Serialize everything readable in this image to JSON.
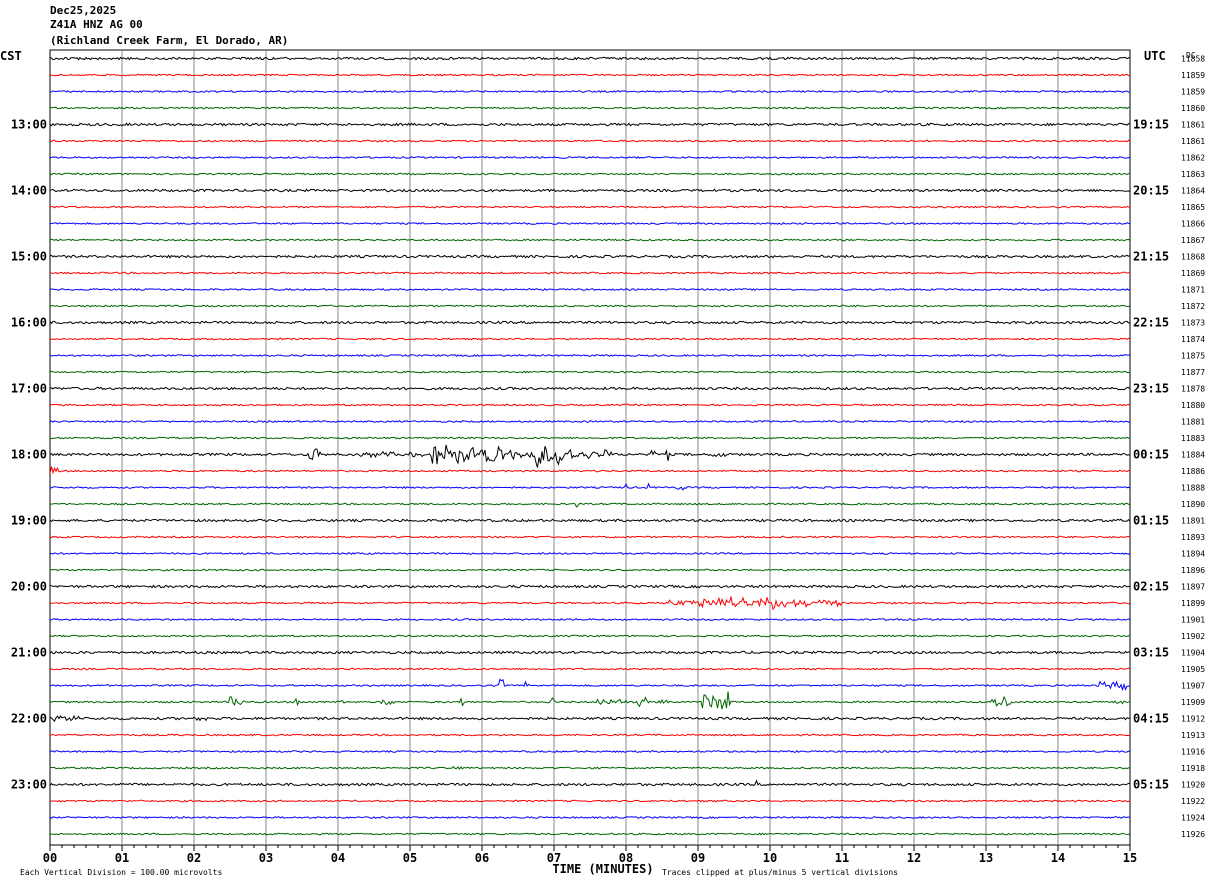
{
  "header": {
    "date": "Dec25,2025",
    "station": "Z41A HNZ AG 00",
    "location": "(Richland Creek Farm, El Dorado, AR)"
  },
  "chart_data": {
    "type": "line",
    "title": "Dec25,2025 Z41A HNZ AG 00 (Richland Creek Farm, El Dorado, AR)",
    "xlabel": "TIME (MINUTES)",
    "xlim": [
      0,
      15
    ],
    "x_ticks": [
      "00",
      "01",
      "02",
      "03",
      "04",
      "05",
      "06",
      "07",
      "08",
      "09",
      "10",
      "11",
      "12",
      "13",
      "14",
      "15"
    ],
    "left_axis_label": "CST",
    "right_axis_label": "UTC",
    "dc_label": "DC",
    "left_hour_labels": [
      "13:00",
      "14:00",
      "15:00",
      "16:00",
      "17:00",
      "18:00",
      "19:00",
      "20:00",
      "21:00",
      "22:00",
      "23:00"
    ],
    "right_hour_labels": [
      "19:15",
      "20:15",
      "21:15",
      "22:15",
      "23:15",
      "00:15",
      "01:15",
      "02:15",
      "03:15",
      "04:15",
      "05:15"
    ],
    "first_labeled_trace": 4,
    "trace_count": 48,
    "trace_colors": [
      "#000000",
      "#ff0000",
      "#0000ff",
      "#006600"
    ],
    "dc_values": [
      "11858",
      "11859",
      "11859",
      "11860",
      "11861",
      "11861",
      "11862",
      "11863",
      "11864",
      "11865",
      "11866",
      "11867",
      "11868",
      "11869",
      "11871",
      "11872",
      "11873",
      "11874",
      "11875",
      "11877",
      "11878",
      "11880",
      "11881",
      "11883",
      "11884",
      "11886",
      "11888",
      "11890",
      "11891",
      "11893",
      "11894",
      "11896",
      "11897",
      "11899",
      "11901",
      "11902",
      "11904",
      "11905",
      "11907",
      "11909",
      "11912",
      "11913",
      "11916",
      "11918",
      "11920",
      "11922",
      "11924",
      "11926"
    ],
    "events": [
      {
        "trace": 24,
        "start": 1.8,
        "end": 1.95,
        "amp": 0.12
      },
      {
        "trace": 24,
        "start": 2.55,
        "end": 2.65,
        "amp": 0.1
      },
      {
        "trace": 24,
        "start": 3.6,
        "end": 3.75,
        "amp": 0.55
      },
      {
        "trace": 24,
        "start": 4.3,
        "end": 5.3,
        "amp": 0.18
      },
      {
        "trace": 24,
        "start": 5.3,
        "end": 6.3,
        "amp": 0.75
      },
      {
        "trace": 24,
        "start": 6.3,
        "end": 6.75,
        "amp": 0.35
      },
      {
        "trace": 24,
        "start": 6.75,
        "end": 7.3,
        "amp": 0.9
      },
      {
        "trace": 24,
        "start": 7.3,
        "end": 7.8,
        "amp": 0.35
      },
      {
        "trace": 24,
        "start": 8.35,
        "end": 8.4,
        "amp": 0.6
      },
      {
        "trace": 24,
        "start": 8.55,
        "end": 8.6,
        "amp": 0.8
      },
      {
        "trace": 24,
        "start": 9.2,
        "end": 9.4,
        "amp": 0.2
      },
      {
        "trace": 24,
        "start": 12.8,
        "end": 12.9,
        "amp": 0.15
      },
      {
        "trace": 25,
        "start": 0.0,
        "end": 0.12,
        "amp": 0.3
      },
      {
        "trace": 26,
        "start": 7.95,
        "end": 8.0,
        "amp": 0.3
      },
      {
        "trace": 26,
        "start": 8.3,
        "end": 8.35,
        "amp": 0.35
      },
      {
        "trace": 26,
        "start": 8.7,
        "end": 8.8,
        "amp": 0.3
      },
      {
        "trace": 27,
        "start": 7.3,
        "end": 7.35,
        "amp": 0.3
      },
      {
        "trace": 33,
        "start": 8.6,
        "end": 11.0,
        "amp": 0.25
      },
      {
        "trace": 33,
        "start": 9.0,
        "end": 10.2,
        "amp": 0.45
      },
      {
        "trace": 34,
        "start": 11.7,
        "end": 11.8,
        "amp": 0.1
      },
      {
        "trace": 38,
        "start": 6.25,
        "end": 6.3,
        "amp": 0.5
      },
      {
        "trace": 38,
        "start": 6.6,
        "end": 6.65,
        "amp": 0.55
      },
      {
        "trace": 38,
        "start": 14.55,
        "end": 14.95,
        "amp": 0.35
      },
      {
        "trace": 39,
        "start": 2.5,
        "end": 2.7,
        "amp": 0.35
      },
      {
        "trace": 39,
        "start": 3.4,
        "end": 3.5,
        "amp": 0.3
      },
      {
        "trace": 39,
        "start": 4.0,
        "end": 4.1,
        "amp": 0.3
      },
      {
        "trace": 39,
        "start": 4.6,
        "end": 4.8,
        "amp": 0.25
      },
      {
        "trace": 39,
        "start": 5.7,
        "end": 5.8,
        "amp": 0.3
      },
      {
        "trace": 39,
        "start": 6.95,
        "end": 7.0,
        "amp": 0.3
      },
      {
        "trace": 39,
        "start": 7.6,
        "end": 8.0,
        "amp": 0.2
      },
      {
        "trace": 39,
        "start": 8.15,
        "end": 8.35,
        "amp": 0.35
      },
      {
        "trace": 39,
        "start": 8.45,
        "end": 8.6,
        "amp": 0.2
      },
      {
        "trace": 39,
        "start": 9.05,
        "end": 9.45,
        "amp": 0.7
      },
      {
        "trace": 39,
        "start": 13.05,
        "end": 13.35,
        "amp": 0.35
      },
      {
        "trace": 39,
        "start": 14.75,
        "end": 14.9,
        "amp": 0.2
      },
      {
        "trace": 40,
        "start": 0.0,
        "end": 0.4,
        "amp": 0.2
      },
      {
        "trace": 40,
        "start": 2.0,
        "end": 2.2,
        "amp": 0.15
      },
      {
        "trace": 43,
        "start": 5.6,
        "end": 5.8,
        "amp": 0.1
      },
      {
        "trace": 44,
        "start": 9.8,
        "end": 9.82,
        "amp": 0.35
      }
    ]
  },
  "footer": {
    "vertical_division_note": "Each Vertical Division =  100.00 microvolts",
    "clip_note": "Traces clipped at plus/minus 5 vertical divisions"
  }
}
